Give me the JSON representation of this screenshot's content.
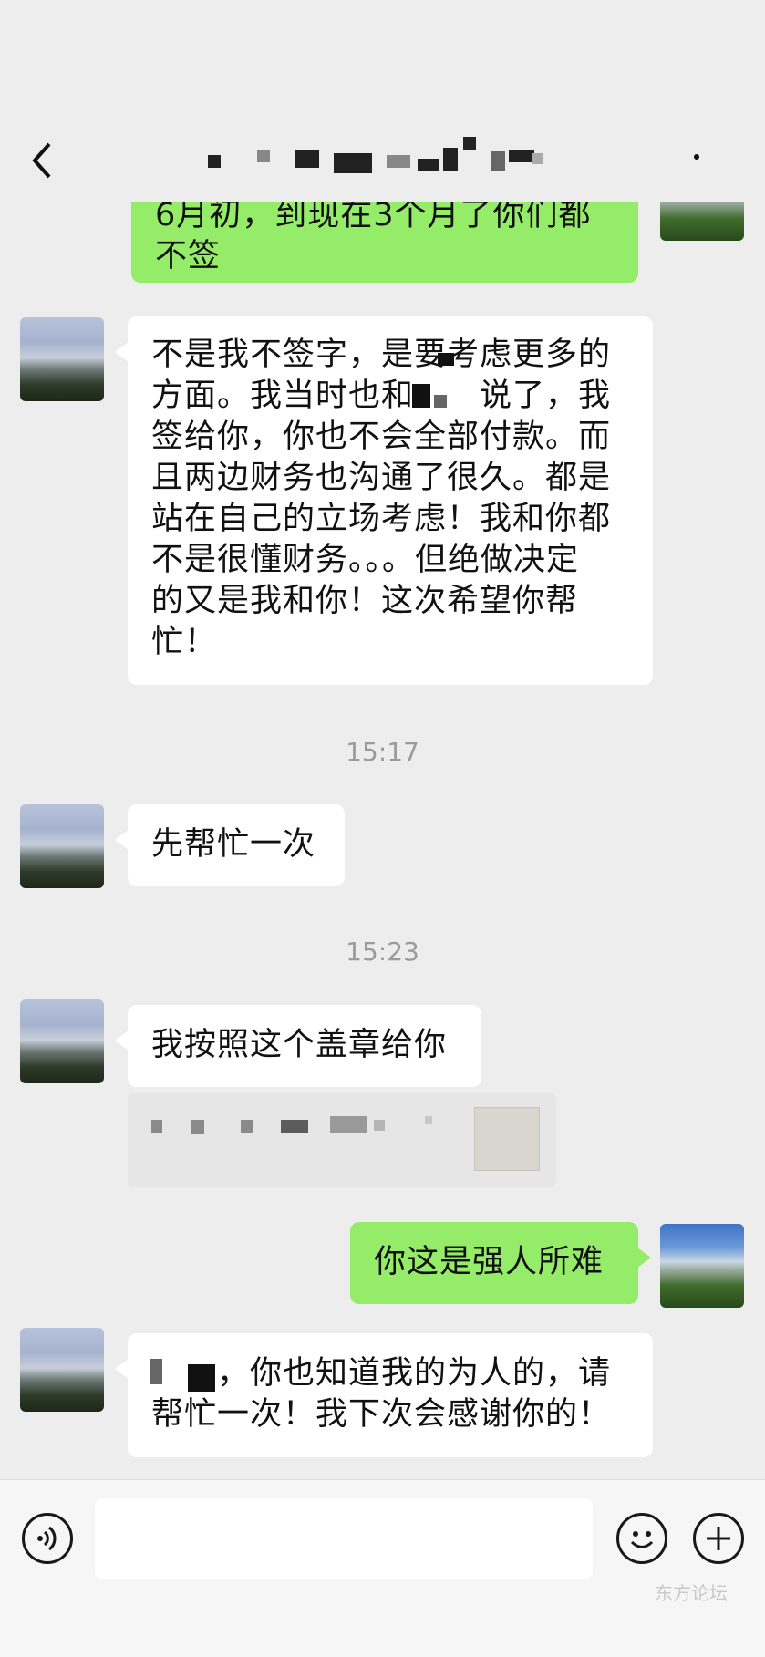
{
  "header": {
    "back_icon": "chevron-left-icon",
    "more_icon": "more-dot-icon"
  },
  "messages": [
    {
      "from": "me",
      "text": "6月初，到现在3个月了你们都\n不签"
    },
    {
      "from": "contact",
      "text": "不是我不签字，是要考虑更多的\n方面。我当时也和　　说了，我\n签给你，你也不会全部付款。而\n且两边财务也沟通了很久。都是\n站在自己的立场考虑！我和你都\n不是很懂财务。。。但绝做决定\n的又是我和你！这次希望你帮\n忙！"
    },
    {
      "time": "15:17"
    },
    {
      "from": "contact",
      "text": "先帮忙一次"
    },
    {
      "time": "15:23"
    },
    {
      "from": "contact",
      "text": "我按照这个盖章给你"
    },
    {
      "from": "contact",
      "type": "file-card"
    },
    {
      "from": "me",
      "text": "你这是强人所难"
    },
    {
      "from": "contact",
      "text": "　　，你也知道我的为人的，请\n帮忙一次！我下次会感谢你的！"
    }
  ],
  "input_bar": {
    "voice_icon": "voice-icon",
    "emoji_icon": "emoji-icon",
    "plus_icon": "plus-icon",
    "message_value": ""
  },
  "watermark": "东方论坛",
  "colors": {
    "background": "#ededed",
    "my_bubble": "#95ec69",
    "their_bubble": "#ffffff",
    "timestamp": "#9b9b9b"
  }
}
